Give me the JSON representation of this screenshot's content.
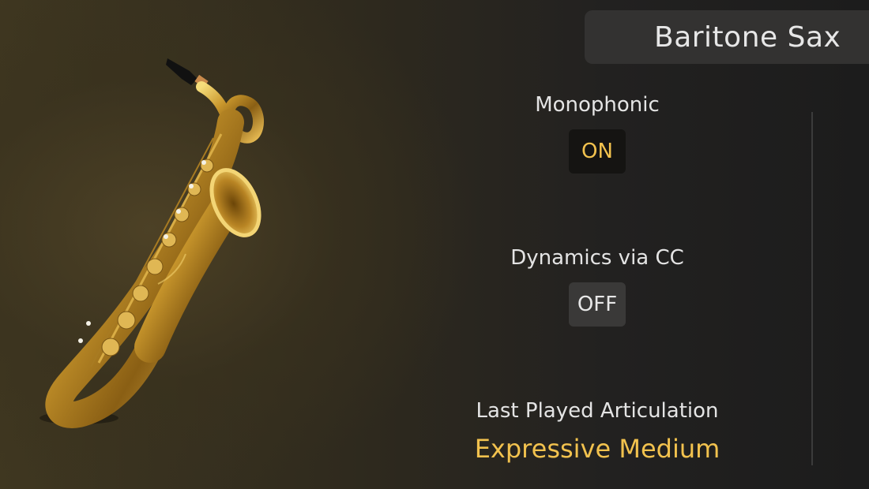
{
  "instrument": {
    "name": "Baritone Sax"
  },
  "settings": [
    {
      "label": "Monophonic",
      "value": "ON"
    },
    {
      "label": "Dynamics via CC",
      "value": "OFF"
    }
  ],
  "articulation": {
    "label": "Last Played Articulation",
    "value": "Expressive Medium"
  },
  "colors": {
    "accent": "#f2c24e",
    "title_bg": "#333231",
    "on_bg": "#151412",
    "off_bg": "#3a3938"
  }
}
